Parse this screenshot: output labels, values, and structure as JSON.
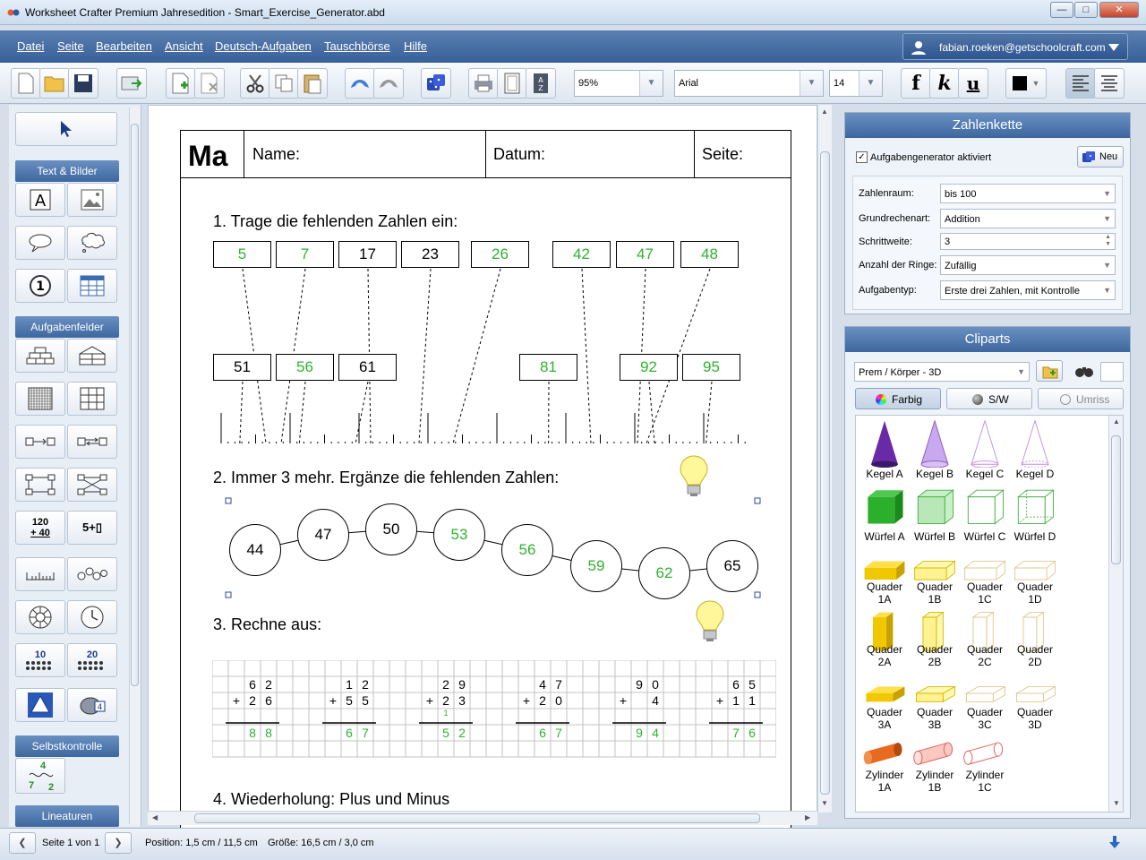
{
  "window": {
    "title": "Worksheet Crafter Premium Jahresedition - Smart_Exercise_Generator.abd",
    "controls": [
      "—",
      "□",
      "✕"
    ]
  },
  "menu": {
    "items": [
      "Datei",
      "Seite",
      "Bearbeiten",
      "Ansicht",
      "Deutsch-Aufgaben",
      "Tauschbörse",
      "Hilfe"
    ],
    "user_email": "fabian.roeken@getschoolcraft.com"
  },
  "toolbar": {
    "zoom": "95%",
    "font": "Arial",
    "font_size": "14",
    "format_f": "f",
    "format_k": "k",
    "format_u": "u"
  },
  "left_panel": {
    "sections": [
      "Text & Bilder",
      "Aufgabenfelder",
      "Selbstkontrolle",
      "Lineaturen"
    ],
    "calc_top": "120",
    "calc_bottom": "+ 40",
    "calc_box": "5+▯",
    "dot_ten": "10",
    "dot_twenty": "20",
    "self_check_top": "4",
    "self_check_left": "7",
    "self_check_right": "2"
  },
  "worksheet": {
    "header": {
      "subject": "Ma",
      "name": "Name:",
      "date": "Datum:",
      "page": "Seite:"
    },
    "task1": {
      "title": "1. Trage die fehlenden Zahlen ein:",
      "row1": [
        {
          "v": "5",
          "green": true
        },
        {
          "v": "7",
          "green": true
        },
        {
          "v": "17",
          "green": false
        },
        {
          "v": "23",
          "green": false
        },
        {
          "v": "26",
          "green": true
        },
        {
          "v": "42",
          "green": true
        },
        {
          "v": "47",
          "green": true
        },
        {
          "v": "48",
          "green": true
        }
      ],
      "row2": [
        {
          "v": "51",
          "green": false
        },
        {
          "v": "56",
          "green": true
        },
        {
          "v": "61",
          "green": false
        },
        {
          "v": "81",
          "green": true
        },
        {
          "v": "92",
          "green": true
        },
        {
          "v": "95",
          "green": true
        }
      ]
    },
    "task2": {
      "title": "2. Immer 3 mehr. Ergänze die fehlenden Zahlen:",
      "chain": [
        {
          "v": "44",
          "green": false
        },
        {
          "v": "47",
          "green": false
        },
        {
          "v": "50",
          "green": false
        },
        {
          "v": "53",
          "green": true
        },
        {
          "v": "56",
          "green": true
        },
        {
          "v": "59",
          "green": true
        },
        {
          "v": "62",
          "green": true
        },
        {
          "v": "65",
          "green": false
        }
      ]
    },
    "task3": {
      "title": "3. Rechne aus:",
      "problems": [
        {
          "a": [
            "6",
            "2"
          ],
          "b": [
            "2",
            "6"
          ],
          "r": [
            "8",
            "8"
          ],
          "carry": ""
        },
        {
          "a": [
            "1",
            "2"
          ],
          "b": [
            "5",
            "5"
          ],
          "r": [
            "6",
            "7"
          ],
          "carry": ""
        },
        {
          "a": [
            "2",
            "9"
          ],
          "b": [
            "2",
            "3"
          ],
          "r": [
            "5",
            "2"
          ],
          "carry": "1"
        },
        {
          "a": [
            "4",
            "7"
          ],
          "b": [
            "2",
            "0"
          ],
          "r": [
            "6",
            "7"
          ],
          "carry": ""
        },
        {
          "a": [
            "9",
            "0"
          ],
          "b": [
            "",
            "4"
          ],
          "r": [
            "9",
            "4"
          ],
          "carry": ""
        },
        {
          "a": [
            "6",
            "5"
          ],
          "b": [
            "1",
            "1"
          ],
          "r": [
            "7",
            "6"
          ],
          "carry": ""
        }
      ],
      "plus": "+"
    },
    "task4": {
      "title": "4. Wiederholung: Plus und Minus"
    }
  },
  "zahlenkette": {
    "title": "Zahlenkette",
    "generator_label": "Aufgabengenerator aktiviert",
    "new_button": "Neu",
    "fields": [
      {
        "label": "Zahlenraum:",
        "value": "bis 100"
      },
      {
        "label": "Grundrechenart:",
        "value": "Addition"
      },
      {
        "label": "Schrittweite:",
        "value": "3"
      },
      {
        "label": "Anzahl der Ringe:",
        "value": "Zufällig"
      },
      {
        "label": "Aufgabentyp:",
        "value": "Erste drei Zahlen, mit Kontrolle"
      }
    ]
  },
  "cliparts": {
    "title": "Cliparts",
    "category": "Prem / Körper - 3D",
    "modes": [
      "Farbig",
      "S/W",
      "Umriss"
    ],
    "items": [
      "Kegel A",
      "Kegel B",
      "Kegel C",
      "Kegel D",
      "Würfel A",
      "Würfel B",
      "Würfel C",
      "Würfel D",
      "Quader 1A",
      "Quader 1B",
      "Quader 1C",
      "Quader 1D",
      "Quader 2A",
      "Quader 2B",
      "Quader 2C",
      "Quader 2D",
      "Quader 3A",
      "Quader 3B",
      "Quader 3C",
      "Quader 3D",
      "Zylinder 1A",
      "Zylinder 1B",
      "Zylinder 1C"
    ]
  },
  "status": {
    "page": "Seite 1 von 1",
    "position": "Position: 1,5 cm / 11,5 cm",
    "size": "Größe: 16,5 cm / 3,0 cm"
  },
  "colors": {
    "accent": "#3d679f",
    "green": "#2fb22f"
  }
}
